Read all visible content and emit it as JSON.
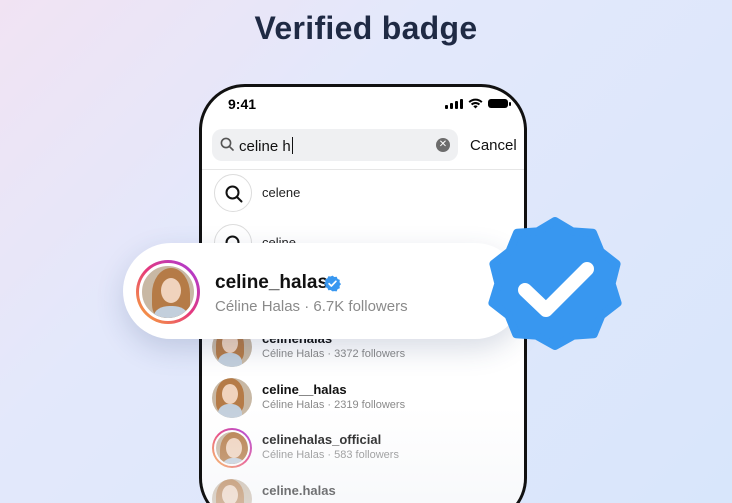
{
  "headline": "Verified badge",
  "status_bar": {
    "time": "9:41"
  },
  "search": {
    "value": "celine h",
    "clear_icon": "close-circle-icon",
    "cancel_label": "Cancel"
  },
  "suggestions": [
    {
      "text": "celene",
      "icon": "search-icon"
    },
    {
      "text": "celine",
      "icon": "search-icon"
    }
  ],
  "featured": {
    "username": "celine_halas",
    "subtitle": "Céline Halas · 6.7K followers",
    "verified": true,
    "verified_color": "#3897f0"
  },
  "results": [
    {
      "username": "celinehalas",
      "subtitle": "Céline Halas · 3372 followers",
      "ring": false
    },
    {
      "username": "celine__halas",
      "subtitle": "Céline Halas · 2319 followers",
      "ring": false
    },
    {
      "username": "celinehalas_official",
      "subtitle": "Céline Halas · 583 followers",
      "ring": true
    },
    {
      "username": "celine.halas",
      "subtitle": "",
      "ring": false
    }
  ],
  "colors": {
    "badge_blue": "#3897f0",
    "ring_gradient": [
      "#f9b233",
      "#e6397a",
      "#a23ae4"
    ]
  }
}
